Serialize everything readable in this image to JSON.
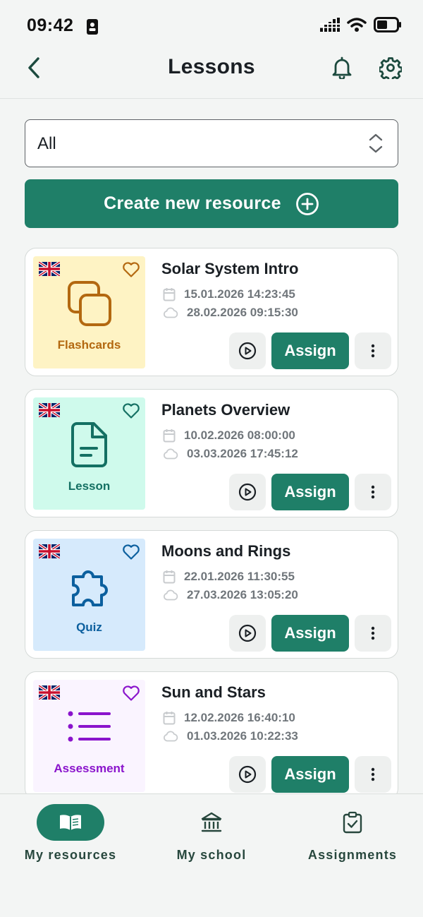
{
  "status_bar": {
    "time": "09:42"
  },
  "header": {
    "title": "Lessons"
  },
  "filter": {
    "value": "All"
  },
  "create_button": {
    "label": "Create new resource"
  },
  "resources": [
    {
      "title": "Solar System Intro",
      "type_label": "Flashcards",
      "icon": "flashcards-icon",
      "created": "15.01.2026 14:23:45",
      "updated": "28.02.2026 09:15:30",
      "bg_color": "#fef3c4",
      "accent_color": "#b36810",
      "assign_label": "Assign"
    },
    {
      "title": "Planets Overview",
      "type_label": "Lesson",
      "icon": "document-icon",
      "created": "10.02.2026 08:00:00",
      "updated": "03.03.2026 17:45:12",
      "bg_color": "#cffaec",
      "accent_color": "#147063",
      "assign_label": "Assign"
    },
    {
      "title": "Moons and Rings",
      "type_label": "Quiz",
      "icon": "puzzle-icon",
      "created": "22.01.2026 11:30:55",
      "updated": "27.03.2026 13:05:20",
      "bg_color": "#d6eafc",
      "accent_color": "#0b5f9e",
      "assign_label": "Assign"
    },
    {
      "title": "Sun and Stars",
      "type_label": "Assessment",
      "icon": "list-icon",
      "created": "12.02.2026 16:40:10",
      "updated": "01.03.2026 10:22:33",
      "bg_color": "#faf4ff",
      "accent_color": "#8a14cc",
      "assign_label": "Assign"
    }
  ],
  "bottom_nav": [
    {
      "label": "My resources",
      "icon": "book-icon",
      "active": true
    },
    {
      "label": "My school",
      "icon": "school-icon",
      "active": false
    },
    {
      "label": "Assignments",
      "icon": "clipboard-check-icon",
      "active": false
    }
  ],
  "colors": {
    "primary": "#1f7f68",
    "nav_text": "#27473d"
  }
}
